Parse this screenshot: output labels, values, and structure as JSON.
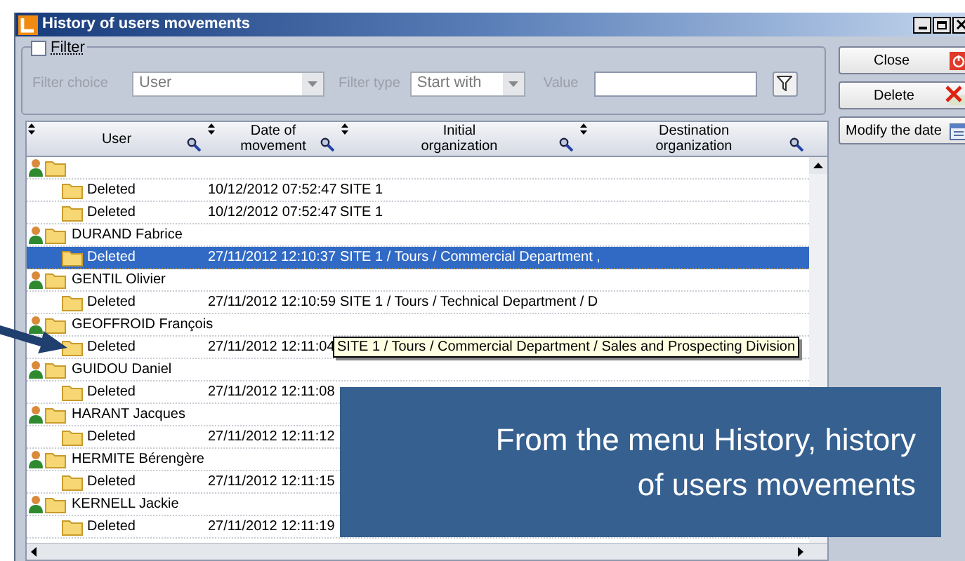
{
  "window": {
    "title": "History of users movements"
  },
  "filter": {
    "label": "Filter",
    "checked": false,
    "choice_label": "Filter choice",
    "choice_value": "User",
    "type_label": "Filter type",
    "type_value": "Start with",
    "value_label": "Value"
  },
  "table": {
    "columns": [
      "User",
      "Date of movement",
      "Initial organization",
      "Destination organization"
    ],
    "groups": [
      {
        "children": [
          {
            "movement": "Deleted",
            "date": "10/12/2012 07:52:47",
            "initial": "SITE 1",
            "selected": false
          },
          {
            "movement": "Deleted",
            "date": "10/12/2012 07:52:47",
            "initial": "SITE 1",
            "selected": false
          }
        ]
      },
      {
        "name": "DURAND Fabrice",
        "children": [
          {
            "movement": "Deleted",
            "date": "27/11/2012 12:10:37",
            "initial": "SITE 1 / Tours / Commercial Department ,",
            "selected": true
          }
        ]
      },
      {
        "name": "GENTIL Olivier",
        "children": [
          {
            "movement": "Deleted",
            "date": "27/11/2012 12:10:59",
            "initial": "SITE 1 / Tours / Technical Department / D",
            "selected": false
          }
        ]
      },
      {
        "name": "GEOFFROID François",
        "children": [
          {
            "movement": "Deleted",
            "date": "27/11/2012 12:11:04",
            "selected": false
          }
        ]
      },
      {
        "name": "GUIDOU Daniel",
        "children": [
          {
            "movement": "Deleted",
            "date": "27/11/2012 12:11:08",
            "selected": false
          }
        ]
      },
      {
        "name": "HARANT Jacques",
        "children": [
          {
            "movement": "Deleted",
            "date": "27/11/2012 12:11:12",
            "selected": false
          }
        ]
      },
      {
        "name": "HERMITE Bérengère",
        "children": [
          {
            "movement": "Deleted",
            "date": "27/11/2012 12:11:15",
            "selected": false
          }
        ]
      },
      {
        "name": "KERNELL Jackie",
        "children": [
          {
            "movement": "Deleted",
            "date": "27/11/2012 12:11:19",
            "selected": false
          }
        ]
      }
    ]
  },
  "tooltip": {
    "text": "SITE 1 / Tours / Commercial Department / Sales and Prospecting Division"
  },
  "buttons": [
    {
      "label": "Close",
      "kind": "close"
    },
    {
      "label": "Delete",
      "kind": "delete"
    },
    {
      "label": "Modify the date",
      "kind": "date"
    }
  ],
  "callout": {
    "text": "From the menu History, history of users movements"
  }
}
